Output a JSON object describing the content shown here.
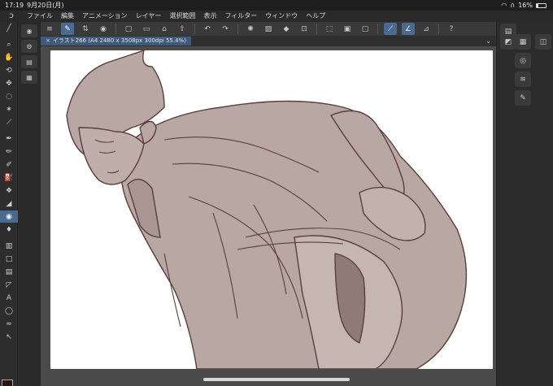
{
  "status_bar": {
    "time": "17:19",
    "date": "9月20日(月)",
    "battery_pct": "16%"
  },
  "menu": {
    "items": [
      "ファイル",
      "編集",
      "アニメーション",
      "レイヤー",
      "選択範囲",
      "表示",
      "フィルター",
      "ウィンドウ",
      "ヘルプ"
    ]
  },
  "document_tab": {
    "title": "イラスト266 (A4 2480 x 3508px 300dpi 55.4%)",
    "close_glyph": "×",
    "menu_glyph": "⌄"
  },
  "colors": {
    "main": "#2a1410",
    "sub": "#e07060",
    "accent": "#4a6a90",
    "line_art": "#5a3f3c",
    "fill": "#b8a7a3"
  }
}
